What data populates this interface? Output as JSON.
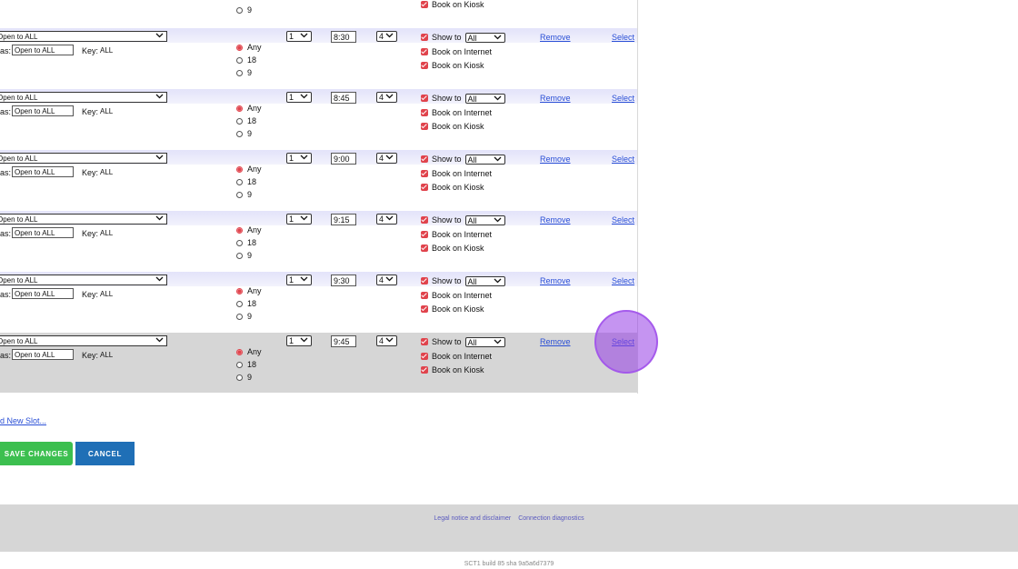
{
  "partial_top": {
    "radio_label": "9",
    "kiosk_label": "Book on Kiosk"
  },
  "slots": [
    {
      "name": "Open to ALL",
      "as_value": "Open to ALL",
      "key_value": "ALL",
      "radio_options": [
        "Any",
        "18",
        "9"
      ],
      "selected_radio": "Any",
      "qty": "1",
      "time": "8:30",
      "players": "4",
      "show_to_label": "Show to",
      "show_to_value": "All",
      "internet_label": "Book on Internet",
      "kiosk_label": "Book on Kiosk",
      "remove_label": "Remove",
      "select_label": "Select"
    },
    {
      "name": "Open to ALL",
      "as_value": "Open to ALL",
      "key_value": "ALL",
      "radio_options": [
        "Any",
        "18",
        "9"
      ],
      "selected_radio": "Any",
      "qty": "1",
      "time": "8:45",
      "players": "4",
      "show_to_label": "Show to",
      "show_to_value": "All",
      "internet_label": "Book on Internet",
      "kiosk_label": "Book on Kiosk",
      "remove_label": "Remove",
      "select_label": "Select"
    },
    {
      "name": "Open to ALL",
      "as_value": "Open to ALL",
      "key_value": "ALL",
      "radio_options": [
        "Any",
        "18",
        "9"
      ],
      "selected_radio": "Any",
      "qty": "1",
      "time": "9:00",
      "players": "4",
      "show_to_label": "Show to",
      "show_to_value": "All",
      "internet_label": "Book on Internet",
      "kiosk_label": "Book on Kiosk",
      "remove_label": "Remove",
      "select_label": "Select"
    },
    {
      "name": "Open to ALL",
      "as_value": "Open to ALL",
      "key_value": "ALL",
      "radio_options": [
        "Any",
        "18",
        "9"
      ],
      "selected_radio": "Any",
      "qty": "1",
      "time": "9:15",
      "players": "4",
      "show_to_label": "Show to",
      "show_to_value": "All",
      "internet_label": "Book on Internet",
      "kiosk_label": "Book on Kiosk",
      "remove_label": "Remove",
      "select_label": "Select"
    },
    {
      "name": "Open to ALL",
      "as_value": "Open to ALL",
      "key_value": "ALL",
      "radio_options": [
        "Any",
        "18",
        "9"
      ],
      "selected_radio": "Any",
      "qty": "1",
      "time": "9:30",
      "players": "4",
      "show_to_label": "Show to",
      "show_to_value": "All",
      "internet_label": "Book on Internet",
      "kiosk_label": "Book on Kiosk",
      "remove_label": "Remove",
      "select_label": "Select"
    },
    {
      "name": "Open to ALL",
      "as_value": "Open to ALL",
      "key_value": "ALL",
      "radio_options": [
        "Any",
        "18",
        "9"
      ],
      "selected_radio": "Any",
      "qty": "1",
      "time": "9:45",
      "players": "4",
      "show_to_label": "Show to",
      "show_to_value": "All",
      "internet_label": "Book on Internet",
      "kiosk_label": "Book on Kiosk",
      "remove_label": "Remove",
      "select_label": "Select"
    }
  ],
  "labels": {
    "as": "as:",
    "key": "Key:"
  },
  "add_slot_label": "d New Slot...",
  "buttons": {
    "save": "SAVE CHANGES",
    "cancel": "CANCEL"
  },
  "footer": {
    "legal": "Legal notice and disclaimer",
    "diagnostics": "Connection diagnostics",
    "build": "SCT1 build 85 sha 9a5a6d7379"
  },
  "colors": {
    "accent_red": "#e0434c",
    "link_blue": "#2a4fd6",
    "save_green": "#3cbf4f",
    "cancel_blue": "#1f6fb6",
    "click_purple": "#9b4de6"
  }
}
